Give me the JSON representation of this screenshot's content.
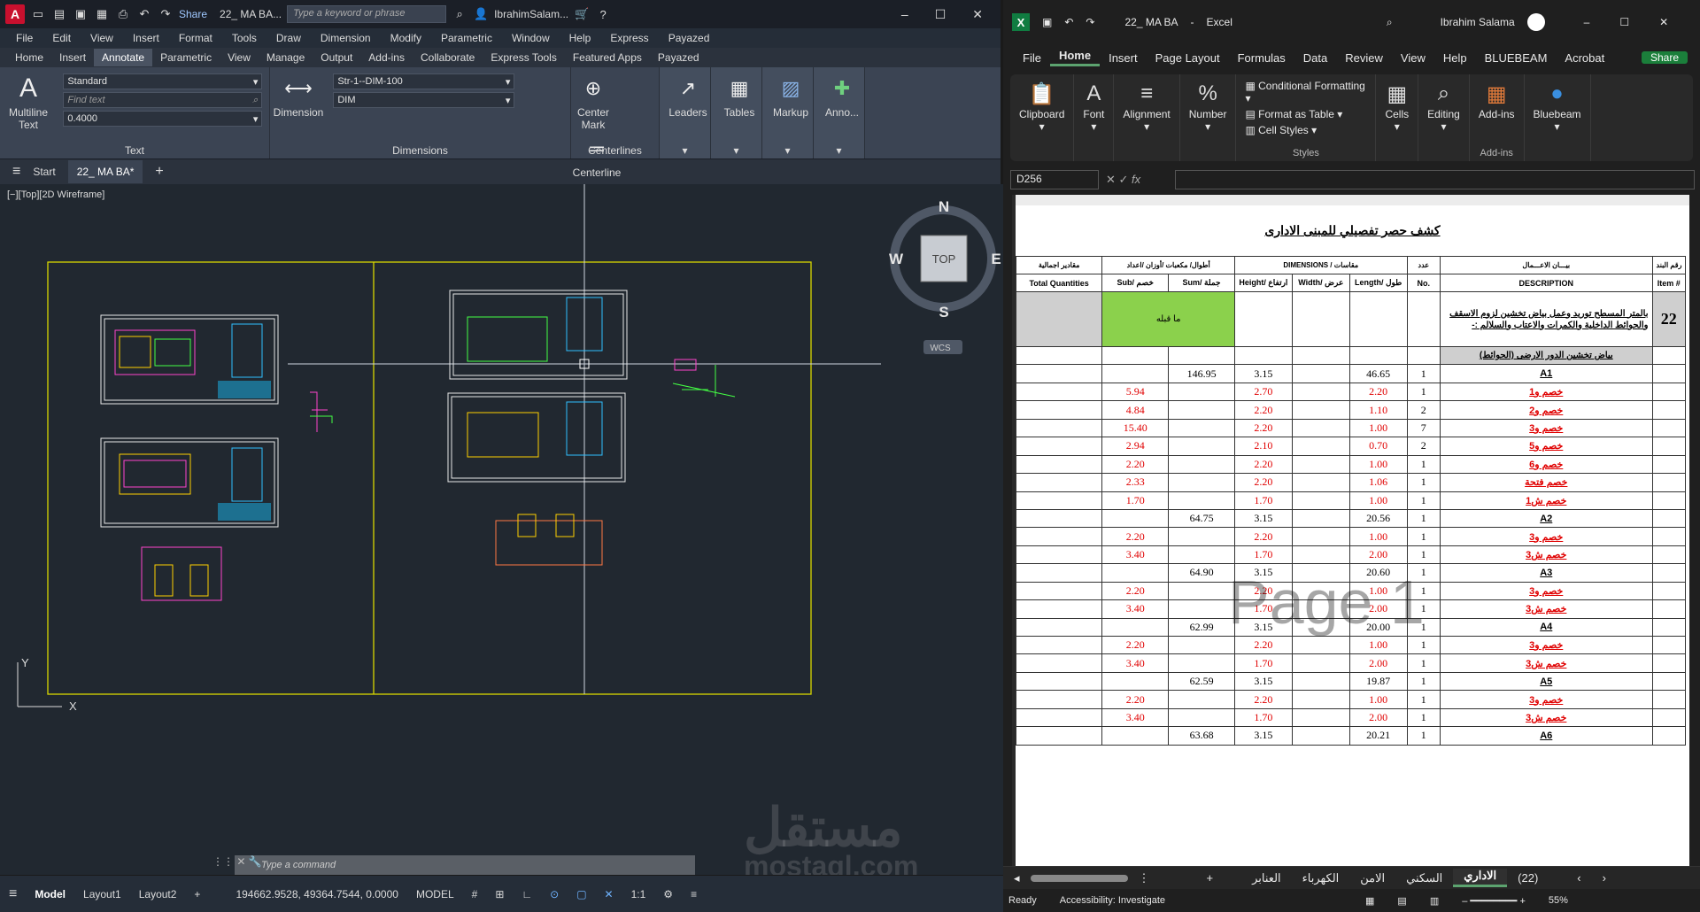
{
  "acad": {
    "title": {
      "file": "22_ MA BA...",
      "search_placeholder": "Type a keyword or phrase",
      "user": "IbrahimSalam...",
      "share": "Share"
    },
    "menu": [
      "File",
      "Edit",
      "View",
      "Insert",
      "Format",
      "Tools",
      "Draw",
      "Dimension",
      "Modify",
      "Parametric",
      "Window",
      "Help",
      "Express",
      "Payazed"
    ],
    "tabs": [
      "Home",
      "Insert",
      "Annotate",
      "Parametric",
      "View",
      "Manage",
      "Output",
      "Add-ins",
      "Collaborate",
      "Express Tools",
      "Featured Apps",
      "Payazed"
    ],
    "active_tab": "Annotate",
    "ribbon": {
      "multiline_text": "Multiline Text",
      "text_style": "Standard",
      "find_text_placeholder": "Find text",
      "text_height": "0.4000",
      "text_panel": "Text",
      "dimension": "Dimension",
      "dim_style": "Str-1--DIM-100",
      "dim_layer": "DIM",
      "dimensions_panel": "Dimensions",
      "center_mark": "Center Mark",
      "centerline": "Centerline",
      "centerlines_panel": "Centerlines",
      "leaders": "Leaders",
      "tables": "Tables",
      "markup": "Markup",
      "anno": "Anno..."
    },
    "doc_tabs": {
      "start": "Start",
      "current": "22_ MA BA*"
    },
    "viewport_label": "[−][Top][2D Wireframe]",
    "viewcube": {
      "n": "N",
      "s": "S",
      "e": "E",
      "w": "W",
      "top": "TOP",
      "wcs": "WCS"
    },
    "command_placeholder": "Type a command",
    "status": {
      "model": "Model",
      "layout1": "Layout1",
      "layout2": "Layout2",
      "coords": "194662.9528, 49364.7544, 0.0000",
      "model_space": "MODEL",
      "scale": "1:1"
    },
    "watermark": "مستقل",
    "watermark_url": "mostaql.com"
  },
  "excel": {
    "title": {
      "file": "22_ MA BA",
      "app": "Excel",
      "user": "Ibrahim Salama"
    },
    "menu": [
      "File",
      "Home",
      "Insert",
      "Page Layout",
      "Formulas",
      "Data",
      "Review",
      "View",
      "Help",
      "BLUEBEAM",
      "Acrobat"
    ],
    "active_menu": "Home",
    "share": "Share",
    "ribbon": {
      "clipboard": "Clipboard",
      "font": "Font",
      "alignment": "Alignment",
      "number": "Number",
      "conditional_formatting": "Conditional Formatting",
      "format_as_table": "Format as Table",
      "cell_styles": "Cell Styles",
      "styles": "Styles",
      "cells": "Cells",
      "editing": "Editing",
      "addins": "Add-ins",
      "addins_group": "Add-ins",
      "bluebeam": "Bluebeam"
    },
    "name_box": "D256",
    "sheet": {
      "title": "كشف حصر تفصيلي للمبنى الادارى",
      "header1": [
        "مقادير اجمالية",
        "أطوال/ مكعبات /أوزان /اعداد",
        "DIMENSIONS  /    مقاسات",
        "عدد",
        "بيـــان الاعـــمال",
        "رقم البند"
      ],
      "header2": [
        "Total Quantities",
        "Sub/ خصم",
        "Sum/ جملة",
        "Height/ ارتفاع",
        "Width/ عرض",
        "Length/ طول",
        "No.",
        "DESCRIPTION",
        "Item #"
      ],
      "item_desc": "بالمتر المسطح توريد وعمل بياض تخشين لزوم الاسقف والحوائط الداخلية والكمرات والاعتاب والسلالم :-",
      "item_no": "22",
      "carried": "ما قبله",
      "section": "بياض تخشين الدور الارضى (الحوائط)",
      "rows": [
        {
          "sub": "",
          "sum": "146.95",
          "h": "3.15",
          "w": "",
          "l": "46.65",
          "no": "1",
          "desc": "A1",
          "red": false
        },
        {
          "sub": "5.94",
          "sum": "",
          "h": "2.70",
          "w": "",
          "l": "2.20",
          "no": "1",
          "desc": "خصم و1",
          "red": true
        },
        {
          "sub": "4.84",
          "sum": "",
          "h": "2.20",
          "w": "",
          "l": "1.10",
          "no": "2",
          "desc": "خصم و2",
          "red": true
        },
        {
          "sub": "15.40",
          "sum": "",
          "h": "2.20",
          "w": "",
          "l": "1.00",
          "no": "7",
          "desc": "خصم و3",
          "red": true
        },
        {
          "sub": "2.94",
          "sum": "",
          "h": "2.10",
          "w": "",
          "l": "0.70",
          "no": "2",
          "desc": "خصم و5",
          "red": true
        },
        {
          "sub": "2.20",
          "sum": "",
          "h": "2.20",
          "w": "",
          "l": "1.00",
          "no": "1",
          "desc": "خصم و6",
          "red": true
        },
        {
          "sub": "2.33",
          "sum": "",
          "h": "2.20",
          "w": "",
          "l": "1.06",
          "no": "1",
          "desc": "خصم فتحة",
          "red": true
        },
        {
          "sub": "1.70",
          "sum": "",
          "h": "1.70",
          "w": "",
          "l": "1.00",
          "no": "1",
          "desc": "خصم ش1",
          "red": true
        },
        {
          "sub": "",
          "sum": "64.75",
          "h": "3.15",
          "w": "",
          "l": "20.56",
          "no": "1",
          "desc": "A2",
          "red": false
        },
        {
          "sub": "2.20",
          "sum": "",
          "h": "2.20",
          "w": "",
          "l": "1.00",
          "no": "1",
          "desc": "خصم و3",
          "red": true
        },
        {
          "sub": "3.40",
          "sum": "",
          "h": "1.70",
          "w": "",
          "l": "2.00",
          "no": "1",
          "desc": "خصم ش3",
          "red": true
        },
        {
          "sub": "",
          "sum": "64.90",
          "h": "3.15",
          "w": "",
          "l": "20.60",
          "no": "1",
          "desc": "A3",
          "red": false
        },
        {
          "sub": "2.20",
          "sum": "",
          "h": "2.20",
          "w": "",
          "l": "1.00",
          "no": "1",
          "desc": "خصم و3",
          "red": true
        },
        {
          "sub": "3.40",
          "sum": "",
          "h": "1.70",
          "w": "",
          "l": "2.00",
          "no": "1",
          "desc": "خصم ش3",
          "red": true
        },
        {
          "sub": "",
          "sum": "62.99",
          "h": "3.15",
          "w": "",
          "l": "20.00",
          "no": "1",
          "desc": "A4",
          "red": false
        },
        {
          "sub": "2.20",
          "sum": "",
          "h": "2.20",
          "w": "",
          "l": "1.00",
          "no": "1",
          "desc": "خصم و3",
          "red": true
        },
        {
          "sub": "3.40",
          "sum": "",
          "h": "1.70",
          "w": "",
          "l": "2.00",
          "no": "1",
          "desc": "خصم ش3",
          "red": true
        },
        {
          "sub": "",
          "sum": "62.59",
          "h": "3.15",
          "w": "",
          "l": "19.87",
          "no": "1",
          "desc": "A5",
          "red": false
        },
        {
          "sub": "2.20",
          "sum": "",
          "h": "2.20",
          "w": "",
          "l": "1.00",
          "no": "1",
          "desc": "خصم و3",
          "red": true
        },
        {
          "sub": "3.40",
          "sum": "",
          "h": "1.70",
          "w": "",
          "l": "2.00",
          "no": "1",
          "desc": "خصم ش3",
          "red": true
        },
        {
          "sub": "",
          "sum": "63.68",
          "h": "3.15",
          "w": "",
          "l": "20.21",
          "no": "1",
          "desc": "A6",
          "red": false
        }
      ],
      "page_watermark": "Page 1"
    },
    "sheet_tabs": [
      "العنابر",
      "الكهرباء",
      "الامن",
      "السكني",
      "الاداري",
      "(22)"
    ],
    "active_sheet": "الاداري",
    "status": {
      "ready": "Ready",
      "accessibility": "Accessibility: Investigate",
      "zoom": "55%"
    }
  }
}
